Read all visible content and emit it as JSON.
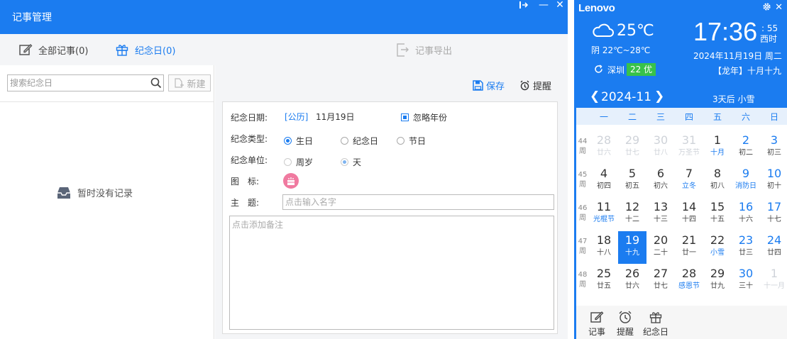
{
  "window": {
    "title": "记事管理",
    "controls": {
      "pin": "⊪",
      "minimize": "—",
      "close": "✕"
    }
  },
  "toolbar": {
    "tab_all_notes": "全部记事(0)",
    "tab_anniversary": "纪念日(0)",
    "export_label": "记事导出"
  },
  "left_pane": {
    "search_placeholder": "搜索纪念日",
    "new_button": "新建",
    "empty_text": "暂时没有记录"
  },
  "right_pane": {
    "save_label": "保存",
    "remind_label": "提醒",
    "form": {
      "date_label": "纪念日期:",
      "calendar_type": "[公历]",
      "date_value": "11月19日",
      "ignore_year_label": "忽略年份",
      "type_label": "纪念类型:",
      "type_options": [
        "生日",
        "纪念日",
        "节日"
      ],
      "type_selected": "生日",
      "unit_label": "纪念单位:",
      "unit_options": [
        "周岁",
        "天"
      ],
      "unit_selected": "天",
      "icon_label": "图　标:",
      "subject_label": "主　题:",
      "subject_placeholder": "点击输入名字",
      "note_placeholder": "点击添加备注"
    }
  },
  "widget": {
    "brand": "Lenovo",
    "close": "✕",
    "temperature": "25℃",
    "weather_desc": "阴 22℃~28℃",
    "city": "深圳",
    "aqi": "22 优",
    "time": "17:36",
    "seconds": ": 55",
    "zone": "西时",
    "date": "2024年11月19日  周二",
    "lunar": "【龙年】十月十九",
    "month": "2024-11",
    "prev": "❮",
    "next": "❯",
    "forecast": "3天后  小雪",
    "weekdays": [
      "一",
      "二",
      "三",
      "四",
      "五",
      "六",
      "日"
    ],
    "week_numbers": [
      "44",
      "45",
      "46",
      "47",
      "48"
    ],
    "week_suffix": "周",
    "weeks": [
      [
        {
          "d": "28",
          "l": "廿六",
          "t": "other"
        },
        {
          "d": "29",
          "l": "廿七",
          "t": "other"
        },
        {
          "d": "30",
          "l": "廿八",
          "t": "other"
        },
        {
          "d": "31",
          "l": "万圣节",
          "t": "other"
        },
        {
          "d": "1",
          "l": "十月",
          "t": "festival"
        },
        {
          "d": "2",
          "l": "初二",
          "t": "weekend"
        },
        {
          "d": "3",
          "l": "初三",
          "t": "weekend"
        }
      ],
      [
        {
          "d": "4",
          "l": "初四",
          "t": ""
        },
        {
          "d": "5",
          "l": "初五",
          "t": ""
        },
        {
          "d": "6",
          "l": "初六",
          "t": ""
        },
        {
          "d": "7",
          "l": "立冬",
          "t": "festival"
        },
        {
          "d": "8",
          "l": "初八",
          "t": ""
        },
        {
          "d": "9",
          "l": "消防日",
          "t": "weekend festival"
        },
        {
          "d": "10",
          "l": "初十",
          "t": "weekend"
        }
      ],
      [
        {
          "d": "11",
          "l": "光棍节",
          "t": "festival"
        },
        {
          "d": "12",
          "l": "十二",
          "t": ""
        },
        {
          "d": "13",
          "l": "十三",
          "t": ""
        },
        {
          "d": "14",
          "l": "十四",
          "t": ""
        },
        {
          "d": "15",
          "l": "十五",
          "t": ""
        },
        {
          "d": "16",
          "l": "十六",
          "t": "weekend"
        },
        {
          "d": "17",
          "l": "十七",
          "t": "weekend"
        }
      ],
      [
        {
          "d": "18",
          "l": "十八",
          "t": ""
        },
        {
          "d": "19",
          "l": "十九",
          "t": "today"
        },
        {
          "d": "20",
          "l": "二十",
          "t": ""
        },
        {
          "d": "21",
          "l": "廿一",
          "t": ""
        },
        {
          "d": "22",
          "l": "小雪",
          "t": "festival"
        },
        {
          "d": "23",
          "l": "廿三",
          "t": "weekend"
        },
        {
          "d": "24",
          "l": "廿四",
          "t": "weekend"
        }
      ],
      [
        {
          "d": "25",
          "l": "廿五",
          "t": ""
        },
        {
          "d": "26",
          "l": "廿六",
          "t": ""
        },
        {
          "d": "27",
          "l": "廿七",
          "t": ""
        },
        {
          "d": "28",
          "l": "感恩节",
          "t": "festival"
        },
        {
          "d": "29",
          "l": "廿九",
          "t": ""
        },
        {
          "d": "30",
          "l": "三十",
          "t": "weekend"
        },
        {
          "d": "1",
          "l": "十一月",
          "t": "other"
        }
      ]
    ],
    "quick": [
      "记事",
      "提醒",
      "纪念日"
    ]
  }
}
